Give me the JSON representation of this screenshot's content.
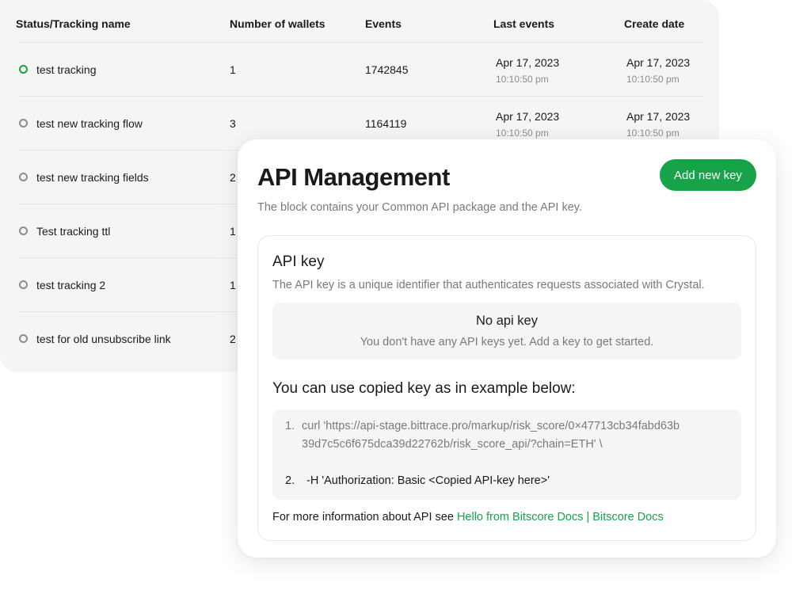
{
  "table": {
    "headers": {
      "status": "Status/Tracking name",
      "wallets": "Number of wallets",
      "events": "Events",
      "last_events": "Last events",
      "create_date": "Create date"
    },
    "rows": [
      {
        "name": "test tracking",
        "active": true,
        "wallets": "1",
        "events": "1742845",
        "last_date": "Apr 17, 2023",
        "last_time": "10:10:50 pm",
        "create_date": "Apr 17, 2023",
        "create_time": "10:10:50 pm"
      },
      {
        "name": "test new tracking flow",
        "active": false,
        "wallets": "3",
        "events": "1164119",
        "last_date": "Apr 17, 2023",
        "last_time": "10:10:50 pm",
        "create_date": "Apr 17, 2023",
        "create_time": "10:10:50 pm"
      },
      {
        "name": "test new tracking fields",
        "active": false,
        "wallets": "2"
      },
      {
        "name": "Test tracking ttl",
        "active": false,
        "wallets": "1"
      },
      {
        "name": "test tracking 2",
        "active": false,
        "wallets": "1"
      },
      {
        "name": "test for old unsubscribe link",
        "active": false,
        "wallets": "2"
      }
    ],
    "colors": {
      "active": "#1aa340",
      "inactive": "#8c8c8c"
    }
  },
  "api": {
    "title": "API Management",
    "subtitle": "The block contains your Common API package and the API key.",
    "add_button": "Add new key",
    "key_section": {
      "title": "API key",
      "description": "The API key is a unique identifier that authenticates requests associated with Crystal.",
      "empty_title": "No api key",
      "empty_description": "You don't have any API keys yet. Add a key to get started."
    },
    "example": {
      "title": "You can use copied key as in example below:",
      "line1_num": "1.",
      "line1_a": "curl 'https://api-stage.bittrace.pro/markup/risk_score/0×47713cb34fabd63b",
      "line1_b": "39d7c5c6f675dca39d22762b/risk_score_api/?chain=ETH' \\",
      "line2_num": "2.",
      "line2": "-H 'Authorization: Basic <Copied API-key here>'"
    },
    "info_prefix": "For more information about API see",
    "info_link": "Hello from Bitscore Docs | Bitscore Docs",
    "accent_color": "#17a34a"
  }
}
